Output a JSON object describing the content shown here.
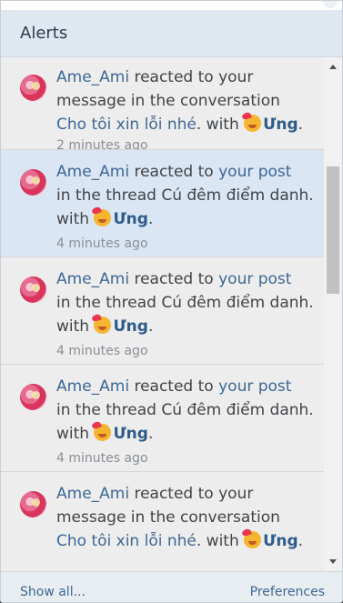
{
  "header": {
    "title": "Alerts"
  },
  "alerts": [
    {
      "user": "Ame_Ami",
      "line1_action": " reacted to your",
      "line2": "message in the conversation",
      "line3_link": "Cho tôi xin lỗi nhé",
      "line3_tail": ". with ",
      "reaction": "Ưng",
      "after_reaction": ".",
      "time": "2 minutes ago"
    },
    {
      "user": "Ame_Ami",
      "line1_action": " reacted to ",
      "line1_link": "your post",
      "line2": "in the thread Cú đêm điểm danh.",
      "line3_lead": "with ",
      "reaction": "Ưng",
      "after_reaction": ".",
      "time": "4 minutes ago"
    },
    {
      "user": "Ame_Ami",
      "line1_action": " reacted to ",
      "line1_link": "your post",
      "line2": "in the thread Cú đêm điểm danh.",
      "line3_lead": "with ",
      "reaction": "Ưng",
      "after_reaction": ".",
      "time": "4 minutes ago"
    },
    {
      "user": "Ame_Ami",
      "line1_action": " reacted to ",
      "line1_link": "your post",
      "line2": "in the thread Cú đêm điểm danh.",
      "line3_lead": "with ",
      "reaction": "Ưng",
      "after_reaction": ".",
      "time": "4 minutes ago"
    },
    {
      "user": "Ame_Ami",
      "line1_action": " reacted to your",
      "line2": "message in the conversation",
      "line3_link": "Cho tôi xin lỗi nhé",
      "line3_tail": ". with ",
      "reaction": "Ưng",
      "after_reaction": "."
    }
  ],
  "icons": {
    "avatar": "user-avatar",
    "reaction": "reaction-emoji-icon"
  },
  "footer": {
    "show_all": "Show all...",
    "preferences": "Preferences"
  },
  "colors": {
    "link": "#3d6796",
    "selected": "#dbe6f4",
    "header": "#dfe7f1"
  }
}
